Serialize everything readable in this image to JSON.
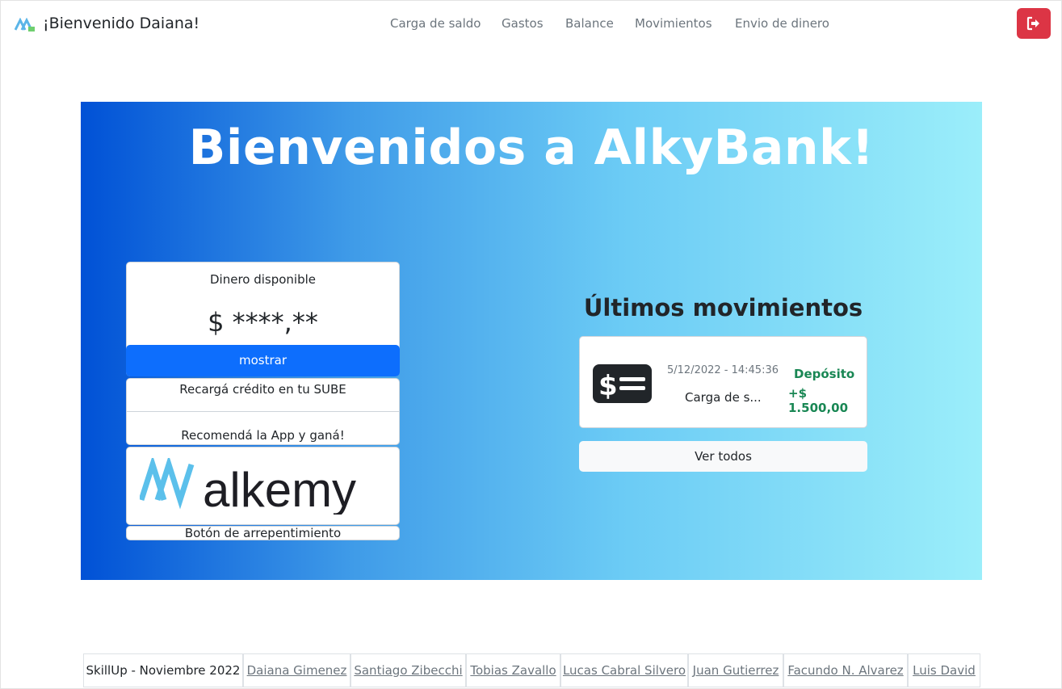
{
  "navbar": {
    "welcome": "¡Bienvenido Daiana!",
    "links": [
      "Carga de saldo",
      "Gastos",
      "Balance",
      "Movimientos",
      "Envio de dinero"
    ],
    "logout_icon": "sign-out-icon",
    "logout_color": "#dc3545"
  },
  "hero": {
    "title": "Bienvenidos a AlkyBank!",
    "gradient": [
      "#0051d6",
      "#9beefa"
    ]
  },
  "balance": {
    "label": "Dinero disponible",
    "amount": "$ ****,**",
    "show_label": "mostrar"
  },
  "promos": {
    "sube": "Recargá crédito en tu SUBE",
    "recommend": "Recomendá la App y ganá!",
    "brand_logo": "alkemy",
    "regret_label": "Botón de arrepentimiento"
  },
  "movements": {
    "title": "Últimos movimientos",
    "items": [
      {
        "icon": "cash-icon",
        "date": "5/12/2022 - 14:45:36",
        "description": "Carga de s...",
        "type": "Depósito",
        "amount": "+$ 1.500,00",
        "color": "#198754"
      }
    ],
    "see_all_label": "Ver todos"
  },
  "footer": {
    "label": "SkillUp - Noviembre 2022",
    "authors": [
      "Daiana Gimenez",
      "Santiago Zibecchi",
      "Tobias Zavallo",
      "Lucas Cabral Silvero",
      "Juan Gutierrez",
      "Facundo N. Alvarez",
      "Luis David"
    ]
  }
}
